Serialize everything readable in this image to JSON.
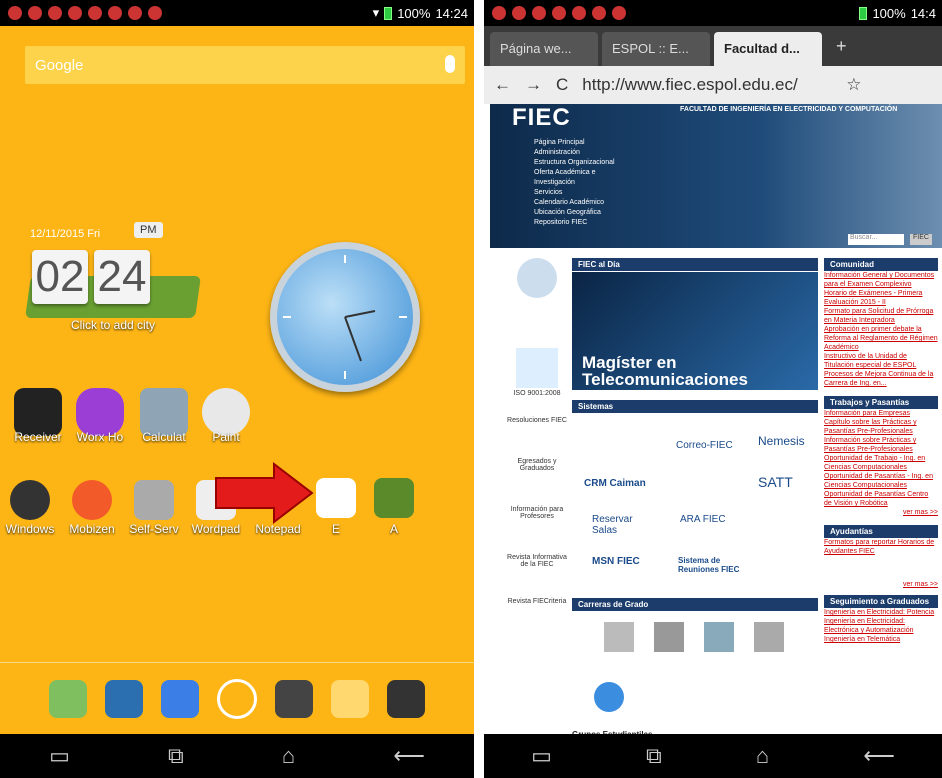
{
  "left": {
    "status": {
      "signal": "100%",
      "time": "14:24"
    },
    "search": {
      "placeholder": "Google"
    },
    "clock": {
      "date": "12/11/2015 Fri",
      "ampm": "PM",
      "hour": "02",
      "minute": "24",
      "city": "Click to add city"
    },
    "apps_row1": [
      "Receiver",
      "Worx Ho",
      "Calculat",
      "Paint"
    ],
    "apps_row2": [
      "Windows",
      "Mobizen",
      "Self-Serv",
      "Wordpad",
      "Notepad",
      "E",
      "A"
    ]
  },
  "right": {
    "status": {
      "signal": "100%",
      "time": "14:4"
    },
    "tabs": [
      "Página we...",
      "ESPOL :: E...",
      "Facultad d..."
    ],
    "url": "http://www.fiec.espol.edu.ec/",
    "site": {
      "logo": "FIEC",
      "faculty": "FACULTAD DE INGENIERÍA EN ELECTRICIDAD Y COMPUTACIÓN",
      "menu": [
        "Página Principal",
        "Administración",
        "Estructura Organizacional",
        "Oferta Académica e",
        "Investigación",
        "Servicios",
        "Calendario Académico",
        "Ubicación Geográfica",
        "Repositorio FIEC"
      ],
      "search_placeholder": "Buscar...",
      "search_button": "FIEC",
      "sections": [
        "FIEC al Día",
        "Sistemas",
        "Carreras de Grado",
        "Grupos Estudiantiles",
        "Comunidad",
        "Trabajos y Pasantías",
        "Ayudantías",
        "Seguimiento a Graduados"
      ],
      "slide": "Magíster en Telecomunicaciones",
      "systems": [
        "Correo-FIEC",
        "Nemesis",
        "CRM Caiman",
        "SATT",
        "Reservar Salas",
        "ARA FIEC",
        "MSN FIEC",
        "Sistema de Reuniones FIEC"
      ],
      "sidebar": [
        "ISO 9001:2008",
        "Resoluciones FIEC",
        "Egresados y Graduados",
        "Información para Profesores",
        "Revista Informativa de la FIEC",
        "Revista FIECriteria"
      ],
      "comunidad": [
        "Información General y Documentos para el Examen Complexivo",
        "Horario de Exámenes - Primera Evaluación 2015 - II",
        "Formato para Solicitud de Prórroga en Materia Integradora",
        "Aprobación en primer debate la Reforma al Reglamento de Régimen Académico",
        "Instructivo de la Unidad de Titulación especial de ESPOL",
        "Procesos de Mejora Continua de la Carrera de Ing. en..."
      ],
      "trabajos": [
        "Información para Empresas",
        "Capítulo sobre las Prácticas y Pasantías Pre-Profesionales",
        "Información sobre Prácticas y Pasantías Pre-Profesionales",
        "Oportunidad de Trabajo - Ing. en Ciencias Computacionales",
        "Oportunidad de Pasantías - Ing. en Ciencias Computacionales",
        "Oportunidad de Pasantías Centro de Visión y Robótica"
      ],
      "ayudantias": "Formatos para reportar Horarios de Ayudantes FIEC",
      "graduados": [
        "Ingeniería en Electricidad: Potencia",
        "Ingeniería en Electricidad: Electrónica y Automatización",
        "Ingeniería en Telemática"
      ],
      "ver_mas": "ver mas >>"
    }
  },
  "colors": {
    "launcher_bg": "#fdb516",
    "arrow": "#e31b1b"
  }
}
